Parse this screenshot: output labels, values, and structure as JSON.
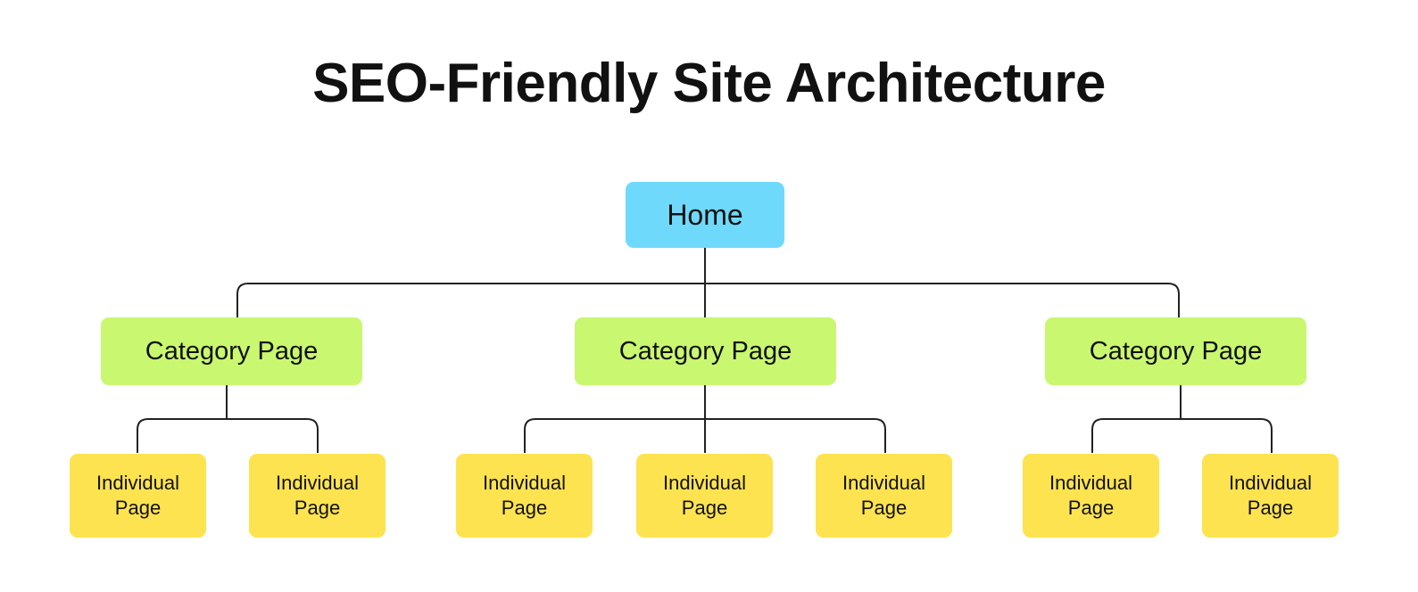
{
  "title": "SEO-Friendly Site Architecture",
  "colors": {
    "home": "#6fd9fc",
    "category": "#c9f76f",
    "individual": "#fde34f",
    "lines": "#222222"
  },
  "home": {
    "label": "Home"
  },
  "categories": [
    {
      "label": "Category Page",
      "children": [
        "Individual\nPage",
        "Individual\nPage"
      ]
    },
    {
      "label": "Category Page",
      "children": [
        "Individual\nPage",
        "Individual\nPage",
        "Individual\nPage"
      ]
    },
    {
      "label": "Category Page",
      "children": [
        "Individual\nPage",
        "Individual\nPage"
      ]
    }
  ]
}
